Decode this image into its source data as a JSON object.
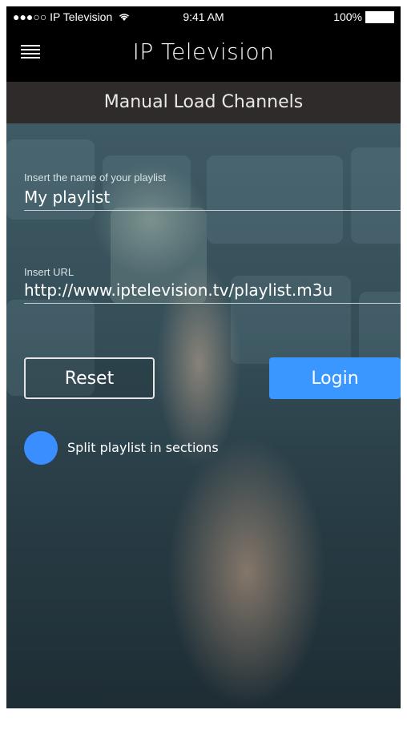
{
  "status_bar": {
    "carrier": "●●●○○ IP Television",
    "wifi_icon": "wifi-icon",
    "time": "9:41 AM",
    "battery": "100%"
  },
  "nav": {
    "title": "IP Television",
    "menu_icon": "menu-icon"
  },
  "subheader": {
    "title": "Manual Load Channels"
  },
  "form": {
    "playlist_name": {
      "label": "Insert the name of your playlist",
      "value": "My playlist"
    },
    "url": {
      "label": "Insert URL",
      "value": "http://www.iptelevision.tv/playlist.m3u"
    },
    "buttons": {
      "reset": "Reset",
      "login": "Login"
    },
    "split_toggle": {
      "label": "Split playlist in sections",
      "on": true
    }
  },
  "colors": {
    "accent": "#3a97ff",
    "nav_background": "#000000",
    "subheader_background": "#2e2b2a"
  }
}
